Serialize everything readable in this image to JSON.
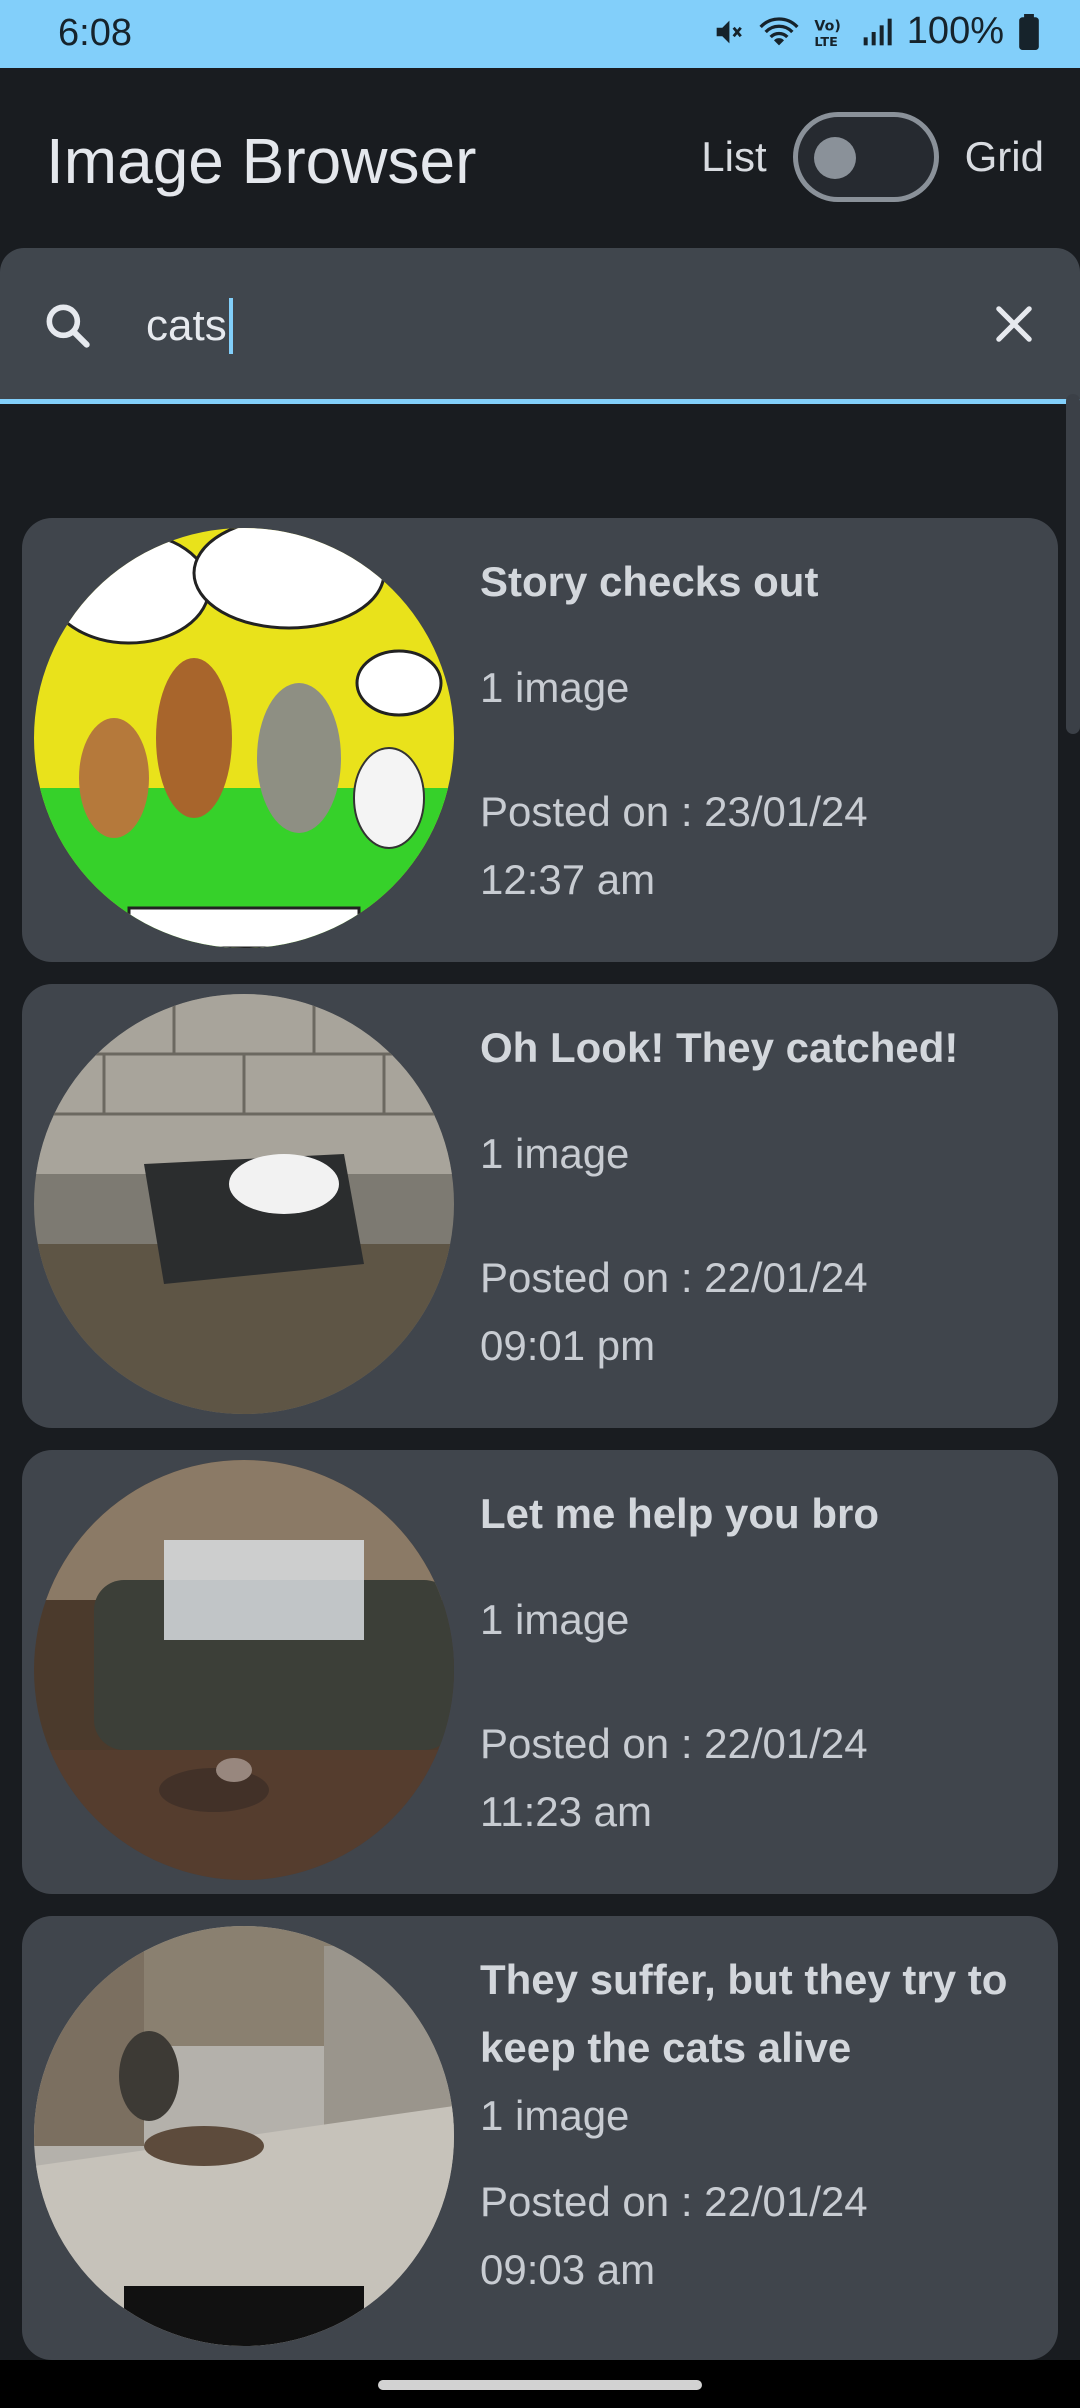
{
  "status_bar": {
    "time": "6:08",
    "battery": "100%",
    "icons": [
      "mute-icon",
      "wifi-icon",
      "volte-icon",
      "signal-icon",
      "battery-icon"
    ]
  },
  "app_bar": {
    "title": "Image Browser",
    "toggle_left": "List",
    "toggle_right": "Grid",
    "toggle_on": false
  },
  "search": {
    "value": "cats",
    "icon": "search-icon",
    "clear_icon": "close-icon"
  },
  "posts": [
    {
      "title": "Story checks out",
      "count": "1 image",
      "posted_on": "Posted on : 23/01/24 12:37 am",
      "thumb_icon": "cartoon-image-icon"
    },
    {
      "title": "Oh Look! They catched!",
      "count": "1 image",
      "posted_on": "Posted on : 22/01/24 09:01 pm",
      "thumb_icon": "photo-image-icon"
    },
    {
      "title": "Let me help you bro",
      "count": "1 image",
      "posted_on": "Posted on : 22/01/24 11:23 am",
      "thumb_icon": "photo-image-icon"
    },
    {
      "title": "They suffer, but they try to keep the cats alive",
      "count": "1 image",
      "posted_on": "Posted on : 22/01/24 09:03 am",
      "thumb_icon": "photo-image-icon"
    }
  ],
  "colors": {
    "accent": "#82cffa",
    "background": "#191c20",
    "card": "#40454c",
    "search_bg": "#40464d"
  }
}
